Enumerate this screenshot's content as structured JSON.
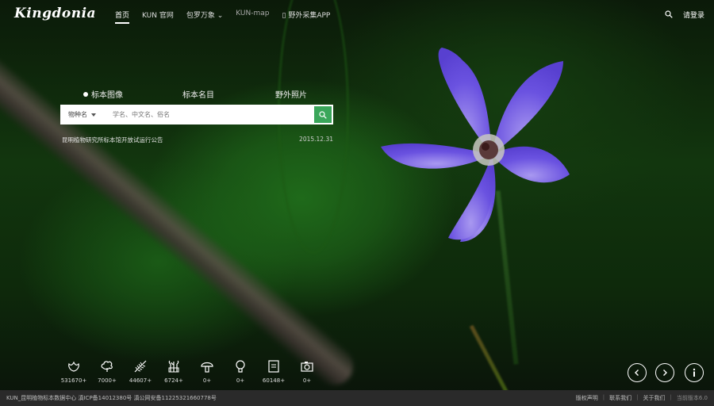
{
  "site": {
    "logo_text": "Kingdonia"
  },
  "nav": {
    "items": [
      {
        "label": "首页"
      },
      {
        "label": "KUN 官网"
      },
      {
        "label": "包罗万象 ⌄"
      },
      {
        "label": "KUN-map"
      },
      {
        "label": "▯ 野外采集APP"
      }
    ],
    "login_label": "请登录"
  },
  "search": {
    "tabs": [
      {
        "label": "标本图像"
      },
      {
        "label": "标本名目"
      },
      {
        "label": "野外照片"
      }
    ],
    "select_value": "物种名",
    "placeholder": "学名、中文名、俗名",
    "notice_text": "昆明植物研究所标本馆开放试运行公告",
    "notice_date": "2015.12.31"
  },
  "stats": [
    {
      "icon": "flower-icon",
      "value": "531670+"
    },
    {
      "icon": "tree-icon",
      "value": "7000+"
    },
    {
      "icon": "fern-icon",
      "value": "44607+"
    },
    {
      "icon": "grass-icon",
      "value": "6724+"
    },
    {
      "icon": "mushroom-icon",
      "value": "0+"
    },
    {
      "icon": "bulb-icon",
      "value": "0+"
    },
    {
      "icon": "document-icon",
      "value": "60148+"
    },
    {
      "icon": "camera-icon",
      "value": "0+"
    }
  ],
  "footer": {
    "left_text": "KUN_昆明植物标本数据中心 滇ICP备14012380号 滇公网安备11225321660778号",
    "links": [
      {
        "label": "版权声明"
      },
      {
        "label": "联系我们"
      },
      {
        "label": "关于我们"
      }
    ],
    "version": "当前版本6.0"
  },
  "colors": {
    "accent_green": "#3aa65a",
    "footer_bg": "#2a2a2a",
    "petal": "#6a52e0"
  }
}
